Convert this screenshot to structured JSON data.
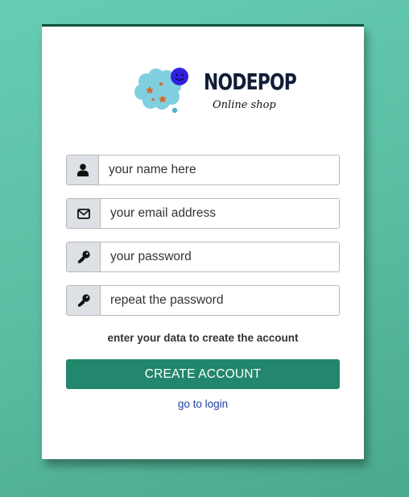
{
  "brand": {
    "name": "NODEPOP",
    "subtitle": "Online shop"
  },
  "form": {
    "name_placeholder": "your name here",
    "email_placeholder": "your email address",
    "password_placeholder": "your password",
    "repeat_password_placeholder": "repeat the password",
    "hint": "enter your data to create the account",
    "submit_label": "CREATE ACCOUNT",
    "login_link": "go to login"
  },
  "icons": {
    "name": "user-icon",
    "email": "envelope-icon",
    "password": "key-icon",
    "repeat_password": "key-icon"
  },
  "colors": {
    "background": "#5bbea3",
    "accent": "#22876c",
    "card_top_border": "#10533f",
    "link": "#1f3fa0"
  }
}
